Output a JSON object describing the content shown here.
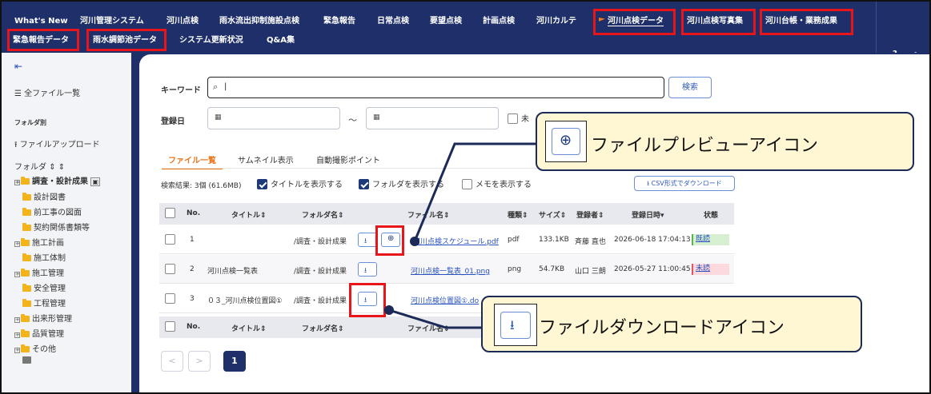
{
  "nav": {
    "row1": [
      "What's New",
      "河川管理システム",
      "河川点検",
      "雨水流出抑制施設点検",
      "緊急報告",
      "日常点検",
      "要望点検",
      "計画点検",
      "河川カルテ",
      "河川点検データ",
      "河川点検写真集",
      "河川台帳・業務成果"
    ],
    "row2": [
      "緊急報告データ",
      "雨水調節池データ",
      "システム更新状況",
      "Q&A集"
    ],
    "help": "ヘルプ"
  },
  "sidebar": {
    "collapse": "⇤",
    "all_files": "全ファイル一覧",
    "by_folder": "フォルダ別",
    "upload": "ファイルアップロード",
    "folder_label": "フォルダ",
    "folders": [
      "調査・設計成果",
      "設計図書",
      "前工事の図面",
      "契約関係書類等",
      "施工計画",
      "施工体制",
      "施工管理",
      "安全管理",
      "工程管理",
      "出来形管理",
      "品質管理",
      "その他"
    ]
  },
  "search": {
    "keyword_label": "キーワード",
    "keyword_value": "|",
    "search_button": "検索",
    "date_label": "登録日",
    "date_sep": "～",
    "partial_label": "未"
  },
  "tabs": [
    "ファイル一覧",
    "サムネイル表示",
    "自動撮影ポイント"
  ],
  "options": {
    "result": "検索結果: 3個 (61.6MB)",
    "show_title": "タイトルを表示する",
    "show_folder": "フォルダを表示する",
    "show_memo": "メモを表示する",
    "csv_button": "CSV形式でダウンロード"
  },
  "table": {
    "headers": [
      "No.",
      "タイトル",
      "フォルダ名",
      "ファイル名",
      "種類",
      "サイズ",
      "登録者",
      "登録日時",
      "状態"
    ],
    "rows": [
      {
        "no": "1",
        "title": "",
        "folder": "/調査・設計成果",
        "file": "河川点検スケジュール.pdf",
        "type": "pdf",
        "size": "133.1KB",
        "user": "斉藤 直也",
        "date": "2026-06-18 17:04:13",
        "status": "既読",
        "status_color": "#d7f0d2"
      },
      {
        "no": "2",
        "title": "河川点検一覧表",
        "folder": "/調査・設計成果",
        "file": "河川点検一覧表_01.png",
        "type": "png",
        "size": "54.7KB",
        "user": "山口 三朗",
        "date": "2026-05-27 11:00:45",
        "status": "未読",
        "status_color": "#fbd9dc"
      },
      {
        "no": "3",
        "title": "０３_河川点検位置図①",
        "folder": "/調査・設計成果",
        "file": "河川点検位置図①.do",
        "type": "",
        "size": "",
        "user": "",
        "date": "",
        "status": "",
        "status_color": ""
      }
    ],
    "footer_headers": [
      "No.",
      "タイトル",
      "フォルダ名",
      "ファイル名"
    ]
  },
  "pagination": {
    "prev": "<",
    "next": ">",
    "current": "1"
  },
  "callouts": {
    "preview": "ファイルプレビューアイコン",
    "download": "ファイルダウンロードアイコン"
  },
  "colors": {
    "nav_bg": "#1e2f69",
    "highlight": "#e8161b",
    "accent_orange": "#e9751b",
    "callout_bg": "#fff6d4"
  }
}
